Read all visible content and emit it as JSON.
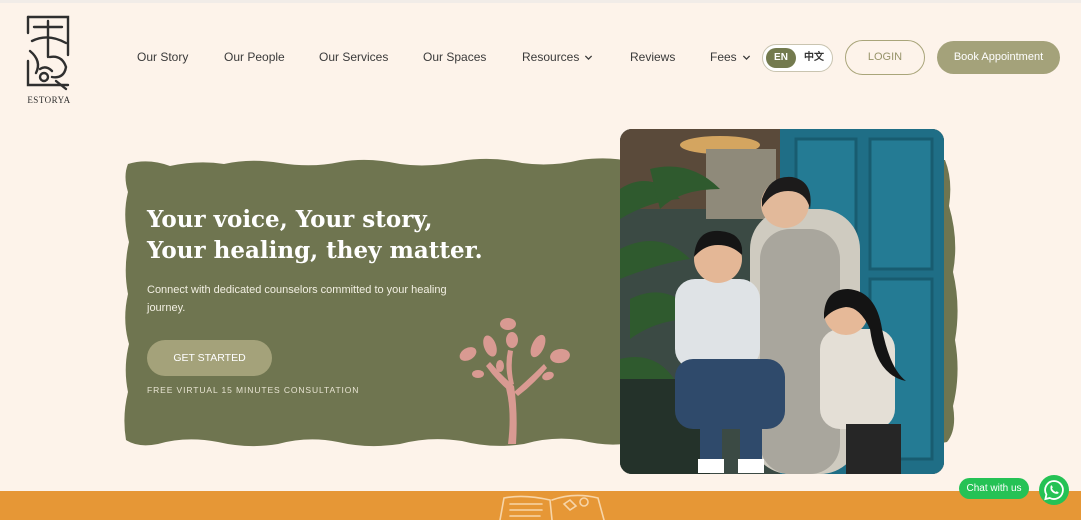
{
  "brand": {
    "logo_text": "ESTORYA"
  },
  "nav": {
    "items": [
      {
        "label": "Our Story"
      },
      {
        "label": "Our People"
      },
      {
        "label": "Our Services"
      },
      {
        "label": "Our Spaces"
      },
      {
        "label": "Resources",
        "has_dropdown": true
      },
      {
        "label": "Reviews"
      },
      {
        "label": "Fees",
        "has_dropdown": true
      }
    ],
    "language": {
      "options": [
        "EN",
        "中文"
      ],
      "selected": "EN"
    },
    "login_label": "LOGIN",
    "book_label": "Book Appointment"
  },
  "hero": {
    "title_line1": "Your voice, Your story,",
    "title_line2": "Your healing, they matter.",
    "subtitle": "Connect with dedicated counselors committed to your healing journey.",
    "cta_label": "GET STARTED",
    "cta_note": "FREE VIRTUAL 15 MINUTES CONSULTATION"
  },
  "chat": {
    "label": "Chat with us",
    "icon": "whatsapp-icon"
  },
  "colors": {
    "background": "#fdf3ea",
    "olive": "#6f7550",
    "button_olive": "#a4a27a",
    "accent_orange": "#e69736",
    "tree_pink": "#d99a92",
    "whatsapp_green": "#25c255"
  }
}
